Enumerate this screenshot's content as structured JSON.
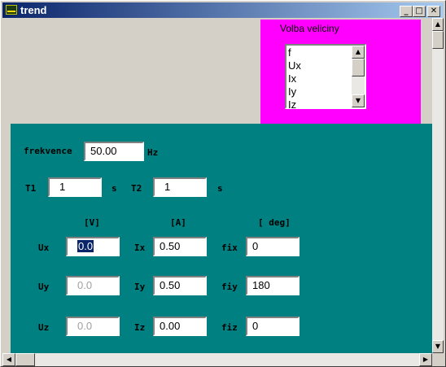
{
  "window": {
    "title": "trend",
    "minimize": "_",
    "maximize": "□",
    "close": "✕"
  },
  "selector": {
    "label": "Volba veliciny",
    "items": [
      "f",
      "Ux",
      "Ix",
      "Iy",
      "Iz"
    ]
  },
  "frequency": {
    "label": "frekvence",
    "value": "50.00",
    "unit": "Hz"
  },
  "times": {
    "t1_label": "T1",
    "t1_value": "1",
    "t1_unit": "s",
    "t2_label": "T2",
    "t2_value": "1",
    "t2_unit": "s"
  },
  "headers": {
    "volts": "[V]",
    "amps": "[A]",
    "degrees": "[ deg]"
  },
  "rows": [
    {
      "u_label": "Ux",
      "u_value": "0.0",
      "i_label": "Ix",
      "i_value": "0.50",
      "fi_label": "fix",
      "fi_value": "0"
    },
    {
      "u_label": "Uy",
      "u_value": "0.0",
      "i_label": "Iy",
      "i_value": "0.50",
      "fi_label": "fiy",
      "fi_value": "180"
    },
    {
      "u_label": "Uz",
      "u_value": "0.0",
      "i_label": "Iz",
      "i_value": "0.00",
      "fi_label": "fiz",
      "fi_value": "0"
    }
  ],
  "icons": {
    "app": "app-icon",
    "scroll_up": "arrow-up-icon",
    "scroll_down": "arrow-down-icon",
    "scroll_left": "arrow-left-icon",
    "scroll_right": "arrow-right-icon"
  },
  "colors": {
    "titlebar_start": "#0a246a",
    "titlebar_end": "#a6caf0",
    "selector_bg": "#ff00ff",
    "panel_bg": "#008080",
    "selection": "#0a246a"
  }
}
